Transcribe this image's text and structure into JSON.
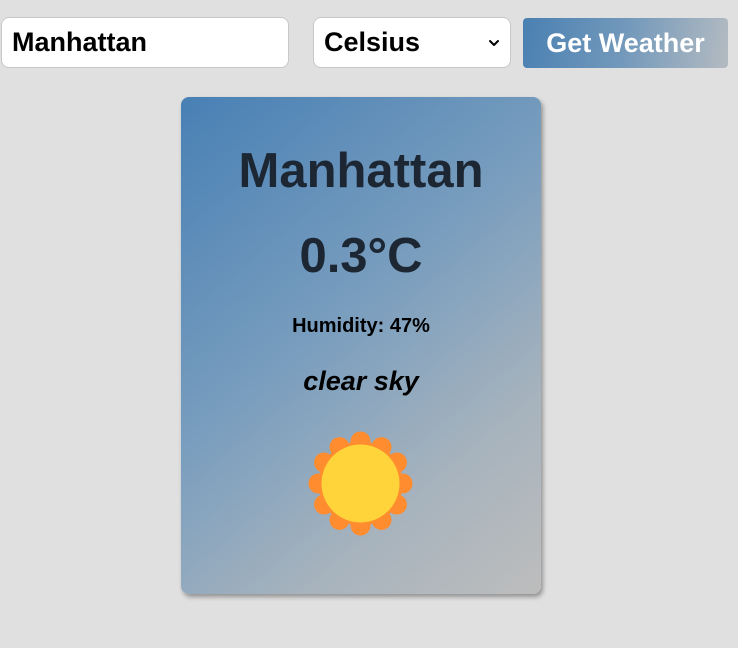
{
  "search": {
    "city_value": "Manhattan",
    "unit_selected": "Celsius",
    "button_label": "Get Weather"
  },
  "weather": {
    "city": "Manhattan",
    "temperature": "0.3°C",
    "humidity": "Humidity: 47%",
    "description": "clear sky",
    "icon": "clear-sky-sun-icon"
  },
  "colors": {
    "background": "#e0e0e0",
    "card_gradient_start": "#4880b5",
    "card_gradient_end": "#bdbdbd",
    "heading_text": "#1d2733",
    "sun_core": "#ffd43b",
    "sun_petals": "#ff8c2e"
  }
}
